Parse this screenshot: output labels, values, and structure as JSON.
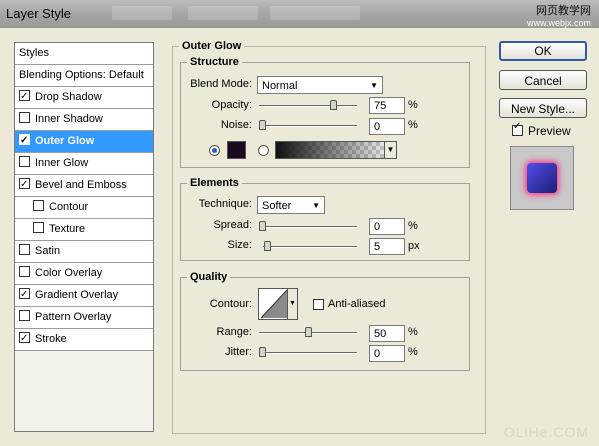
{
  "window": {
    "title": "Layer Style"
  },
  "watermark": {
    "top_cn": "网页教学网",
    "top_url": "www.webjx.com",
    "bottom": "OLiHe.COM",
    "close_glyph": "×"
  },
  "styles_list": {
    "header": "Styles",
    "blending": "Blending Options: Default",
    "items": [
      {
        "label": "Drop Shadow",
        "checked": true,
        "indent": false
      },
      {
        "label": "Inner Shadow",
        "checked": false,
        "indent": false
      },
      {
        "label": "Outer Glow",
        "checked": true,
        "indent": false,
        "selected": true
      },
      {
        "label": "Inner Glow",
        "checked": false,
        "indent": false
      },
      {
        "label": "Bevel and Emboss",
        "checked": true,
        "indent": false
      },
      {
        "label": "Contour",
        "checked": false,
        "indent": true
      },
      {
        "label": "Texture",
        "checked": false,
        "indent": true
      },
      {
        "label": "Satin",
        "checked": false,
        "indent": false
      },
      {
        "label": "Color Overlay",
        "checked": false,
        "indent": false
      },
      {
        "label": "Gradient Overlay",
        "checked": true,
        "indent": false
      },
      {
        "label": "Pattern Overlay",
        "checked": false,
        "indent": false
      },
      {
        "label": "Stroke",
        "checked": true,
        "indent": false
      }
    ]
  },
  "outer_glow": {
    "title": "Outer Glow",
    "structure": {
      "title": "Structure",
      "blend_mode_label": "Blend Mode:",
      "blend_mode": "Normal",
      "opacity_label": "Opacity:",
      "opacity": "75",
      "opacity_value": 75,
      "noise_label": "Noise:",
      "noise": "0",
      "noise_value": 0,
      "percent": "%",
      "glow_color": "#1a0a1e"
    },
    "elements": {
      "title": "Elements",
      "technique_label": "Technique:",
      "technique": "Softer",
      "spread_label": "Spread:",
      "spread": "0",
      "spread_value": 0,
      "size_label": "Size:",
      "size": "5",
      "size_value": 5,
      "percent": "%",
      "px": "px"
    },
    "quality": {
      "title": "Quality",
      "contour_label": "Contour:",
      "anti_aliased_label": "Anti-aliased",
      "anti_aliased": false,
      "range_label": "Range:",
      "range": "50",
      "range_value": 50,
      "jitter_label": "Jitter:",
      "jitter": "0",
      "jitter_value": 0,
      "percent": "%"
    }
  },
  "buttons": {
    "ok": "OK",
    "cancel": "Cancel",
    "new_style": "New Style...",
    "preview_label": "Preview",
    "preview_checked": true
  },
  "colors": {
    "selection": "#3399ff",
    "accent_border": "#2e5aa6",
    "glow_pink": "#ff3c8a"
  }
}
